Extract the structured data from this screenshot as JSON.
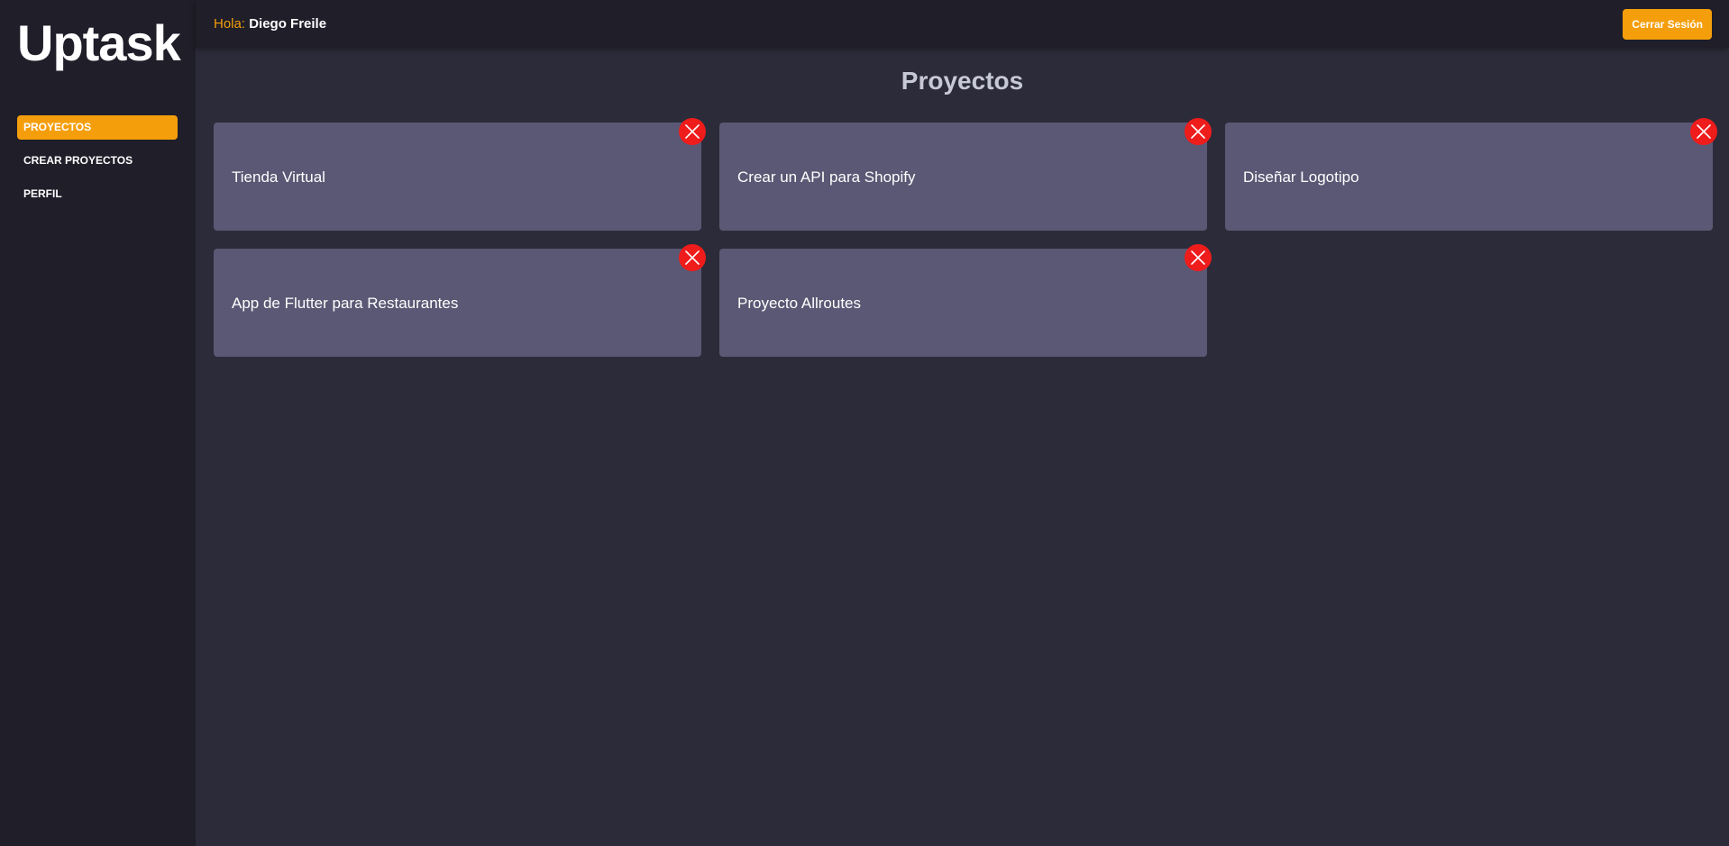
{
  "sidebar": {
    "logo": "Uptask",
    "items": [
      {
        "label": "PROYECTOS",
        "active": true
      },
      {
        "label": "CREAR PROYECTOS",
        "active": false
      },
      {
        "label": "PERFIL",
        "active": false
      }
    ]
  },
  "header": {
    "greeting_label": "Hola:",
    "user_name": "Diego Freile",
    "logout_label": "Cerrar Sesión"
  },
  "main": {
    "title": "Proyectos",
    "projects": [
      {
        "name": "Tienda Virtual"
      },
      {
        "name": "Crear un API para Shopify"
      },
      {
        "name": "Diseñar Logotipo"
      },
      {
        "name": "App de Flutter para Restaurantes"
      },
      {
        "name": "Proyecto Allroutes"
      }
    ]
  },
  "icons": {
    "delete": "close-icon"
  },
  "colors": {
    "accent": "#f59e0b",
    "background": "#2c2b39",
    "sidebar": "#1f1e29",
    "card": "#5a5874",
    "danger": "#ef1c1c"
  }
}
